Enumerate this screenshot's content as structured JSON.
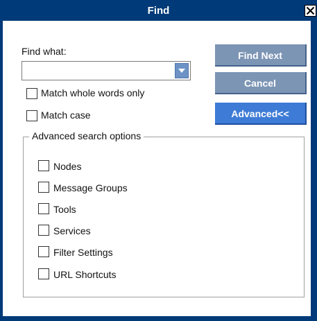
{
  "window": {
    "title": "Find"
  },
  "find_what": {
    "label": "Find what:",
    "value": ""
  },
  "options": {
    "match_whole_words": {
      "label": "Match whole words only",
      "checked": false
    },
    "match_case": {
      "label": "Match case",
      "checked": false
    }
  },
  "buttons": {
    "find_next": "Find Next",
    "cancel": "Cancel",
    "advanced": "Advanced<<"
  },
  "advanced_group": {
    "title": "Advanced search options",
    "items": [
      {
        "label": "Nodes",
        "checked": false
      },
      {
        "label": "Message Groups",
        "checked": false
      },
      {
        "label": "Tools",
        "checked": false
      },
      {
        "label": "Services",
        "checked": false
      },
      {
        "label": "Filter Settings",
        "checked": false
      },
      {
        "label": "URL Shortcuts",
        "checked": false
      }
    ]
  },
  "colors": {
    "titlebar": "#003a78",
    "button_gray": "#7c95b5",
    "button_blue": "#3d7bd6"
  },
  "icons": {
    "close": "close-icon",
    "dropdown": "chevron-down-icon"
  }
}
